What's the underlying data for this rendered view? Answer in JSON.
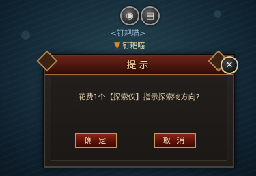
{
  "hud": {
    "icons": [
      "compass-icon",
      "book-icon"
    ],
    "npc_title": "<钉耙喵>",
    "npc_name": "钉耙喵"
  },
  "dialog": {
    "title": "提示",
    "message": "花费1个【探索仪】指示探索物方向?",
    "confirm_label": "确 定",
    "cancel_label": "取 消",
    "close_glyph": "✕"
  },
  "colors": {
    "header": "#6b2418",
    "button": "#8a2416",
    "button_border": "#c29b5b",
    "text": "#d9c9a5"
  }
}
